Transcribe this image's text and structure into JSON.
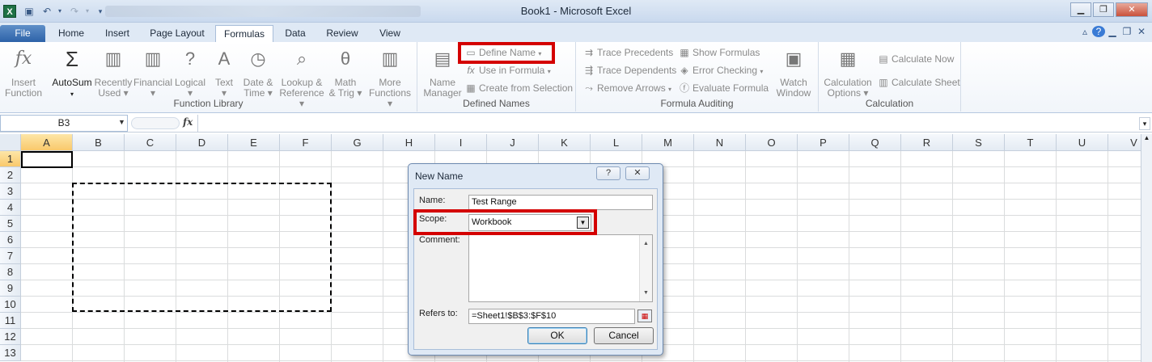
{
  "window": {
    "title": "Book1  -  Microsoft Excel"
  },
  "qat": {
    "app_icon": "X"
  },
  "tabs": [
    {
      "label": "File"
    },
    {
      "label": "Home"
    },
    {
      "label": "Insert"
    },
    {
      "label": "Page Layout"
    },
    {
      "label": "Formulas"
    },
    {
      "label": "Data"
    },
    {
      "label": "Review"
    },
    {
      "label": "View"
    }
  ],
  "ribbon": {
    "function_library": {
      "label": "Function Library",
      "insert_function": [
        "Insert",
        "Function"
      ],
      "autosum": "AutoSum",
      "recently_used": [
        "Recently",
        "Used"
      ],
      "financial": "Financial",
      "logical": "Logical",
      "text": "Text",
      "date_time": [
        "Date &",
        "Time"
      ],
      "lookup": [
        "Lookup &",
        "Reference"
      ],
      "math": [
        "Math",
        "& Trig"
      ],
      "more": [
        "More",
        "Functions"
      ]
    },
    "defined_names": {
      "label": "Defined Names",
      "name_manager": [
        "Name",
        "Manager"
      ],
      "define_name": "Define Name",
      "use_in_formula": "Use in Formula",
      "create_from_selection": "Create from Selection"
    },
    "formula_auditing": {
      "label": "Formula Auditing",
      "trace_precedents": "Trace Precedents",
      "trace_dependents": "Trace Dependents",
      "remove_arrows": "Remove Arrows",
      "show_formulas": "Show Formulas",
      "error_checking": "Error Checking",
      "evaluate_formula": "Evaluate Formula",
      "watch_window": [
        "Watch",
        "Window"
      ]
    },
    "calculation": {
      "label": "Calculation",
      "options": [
        "Calculation",
        "Options"
      ],
      "calculate_now": "Calculate Now",
      "calculate_sheet": "Calculate Sheet"
    }
  },
  "formula_bar": {
    "name_box": "B3",
    "fx": "fx",
    "content": ""
  },
  "grid": {
    "columns": [
      "A",
      "B",
      "C",
      "D",
      "E",
      "F",
      "G",
      "H",
      "I",
      "J",
      "K",
      "L",
      "M",
      "N",
      "O",
      "P",
      "Q",
      "R",
      "S",
      "T",
      "U",
      "V"
    ],
    "rows": [
      "1",
      "2",
      "3",
      "4",
      "5",
      "6",
      "7",
      "8",
      "9",
      "10",
      "11",
      "12",
      "13"
    ]
  },
  "dialog": {
    "title": "New Name",
    "help": "?",
    "close": "✕",
    "name_label": "Name:",
    "name_value": "Test Range",
    "scope_label": "Scope:",
    "scope_value": "Workbook",
    "comment_label": "Comment:",
    "comment_value": "",
    "refers_to_label": "Refers to:",
    "refers_to_value": "=Sheet1!$B$3:$F$10",
    "ok": "OK",
    "cancel": "Cancel"
  },
  "colors": {
    "highlight": "#d40000",
    "accent": "#2d62a8"
  }
}
